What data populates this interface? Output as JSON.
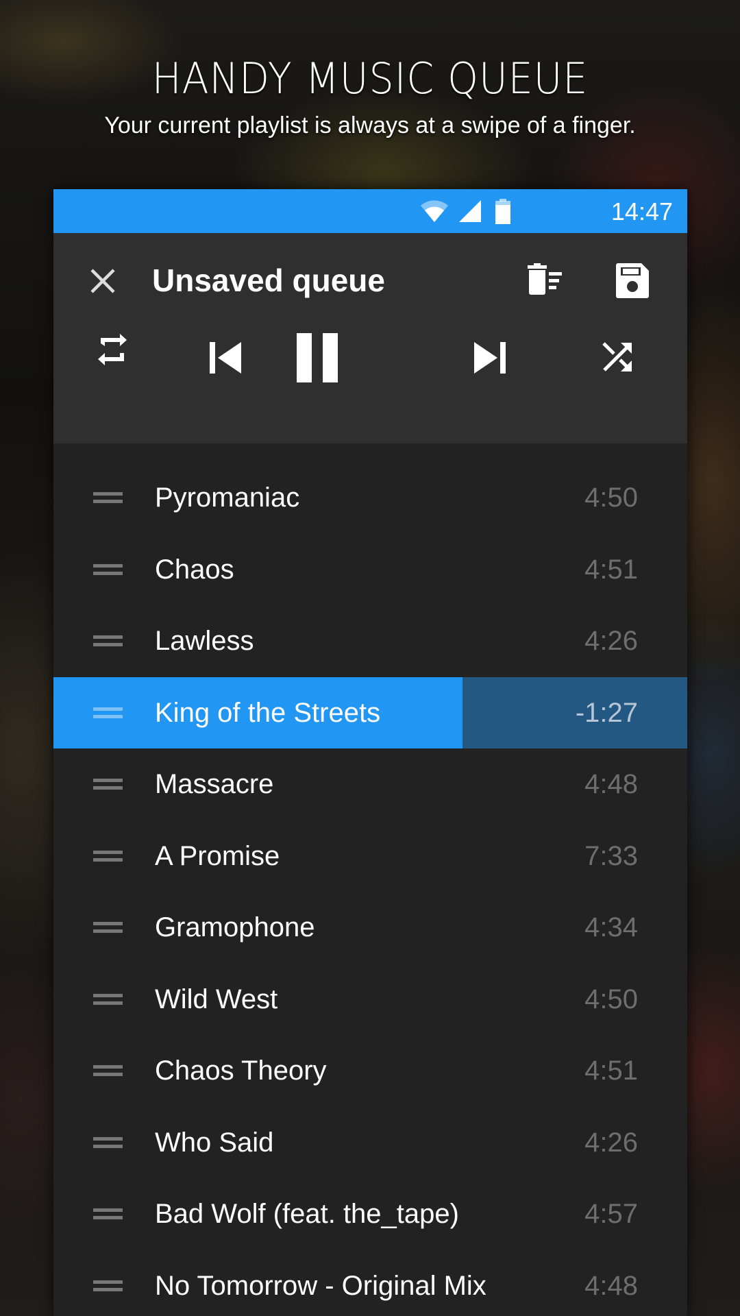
{
  "promo": {
    "title": "HANDY MUSIC QUEUE",
    "subtitle": "Your current playlist is always at a swipe of a finger."
  },
  "status_bar": {
    "time": "14:47",
    "icons": [
      "wifi-icon",
      "cell-signal-icon",
      "battery-icon"
    ],
    "color": "#2196F3"
  },
  "header": {
    "title": "Unsaved queue",
    "close_icon": "close-icon",
    "clear_icon": "clear-queue-icon",
    "save_icon": "save-icon"
  },
  "controls": {
    "repeat": "repeat-icon",
    "previous": "skip-previous-icon",
    "play_pause": "pause-icon",
    "next": "skip-next-icon",
    "shuffle": "shuffle-icon"
  },
  "queue": {
    "now_playing_index": 3,
    "now_playing_progress": 0.645,
    "tracks": [
      {
        "title": "Pyromaniac",
        "duration": "4:50"
      },
      {
        "title": "Chaos",
        "duration": "4:51"
      },
      {
        "title": "Lawless",
        "duration": "4:26"
      },
      {
        "title": "King of the Streets",
        "duration": "-1:27"
      },
      {
        "title": "Massacre",
        "duration": "4:48"
      },
      {
        "title": "A Promise",
        "duration": "7:33"
      },
      {
        "title": "Gramophone",
        "duration": "4:34"
      },
      {
        "title": "Wild West",
        "duration": "4:50"
      },
      {
        "title": "Chaos Theory",
        "duration": "4:51"
      },
      {
        "title": "Who Said",
        "duration": "4:26"
      },
      {
        "title": "Bad Wolf (feat. the_tape)",
        "duration": "4:57"
      },
      {
        "title": "No Tomorrow - Original Mix",
        "duration": "4:48"
      }
    ]
  },
  "colors": {
    "accent": "#2196F3",
    "now_playing_remaining": "#235883",
    "header_bg": "#2f2f2f",
    "list_bg": "#222222",
    "duration_text": "#6e6e6e"
  }
}
